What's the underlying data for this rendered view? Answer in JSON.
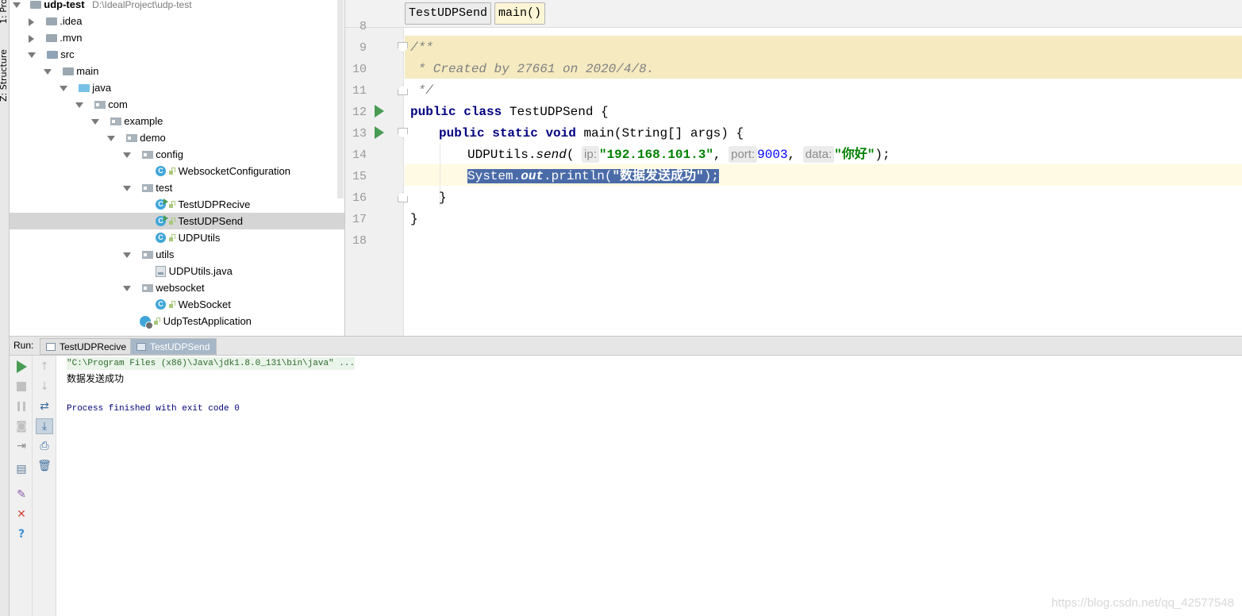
{
  "side_tabs": [
    "1: Pro",
    "Z: Structure"
  ],
  "project": {
    "root_name": "udp-test",
    "root_path": "D:\\IdealProject\\udp-test",
    "nodes": [
      ".idea",
      ".mvn",
      "src",
      "main",
      "java",
      "com",
      "example",
      "demo",
      "config",
      "WebsocketConfiguration",
      "test",
      "TestUDPRecive",
      "TestUDPSend",
      "UDPUtils",
      "utils",
      "UDPUtils.java",
      "websocket",
      "WebSocket",
      "UdpTestApplication"
    ],
    "selected": "TestUDPSend"
  },
  "editor": {
    "breadcrumbs": [
      "TestUDPSend",
      "main()"
    ],
    "line_numbers": [
      "8",
      "9",
      "10",
      "11",
      "12",
      "13",
      "14",
      "15",
      "16",
      "17",
      "18"
    ],
    "lines": {
      "l9": "/**",
      "l10": " * Created by 27661 on 2020/4/8.",
      "l11": " */",
      "l12_kw1": "public",
      "l12_kw2": "class",
      "l12_rest": " TestUDPSend {",
      "l13_kw1": "public",
      "l13_kw2": "static",
      "l13_kw3": "void",
      "l13_rest": " main(String[] args) {",
      "l14_pre": "UDPUtils.",
      "l14_method": "send",
      "l14_paren": "(",
      "l14_hint1": "ip:",
      "l14_str1": "\"192.168.101.3\"",
      "l14_comma1": ", ",
      "l14_hint2": "port:",
      "l14_num": "9003",
      "l14_comma2": ", ",
      "l14_hint3": "data:",
      "l14_str2": "\"你好\"",
      "l14_end": ");",
      "l15_pre": "System.",
      "l15_field": "out",
      "l15_mid": ".println(",
      "l15_str": "\"数据发送成功\"",
      "l15_end": ");",
      "l16": "}",
      "l17": "}"
    }
  },
  "run": {
    "label": "Run:",
    "tabs": [
      "TestUDPRecive",
      "TestUDPSend"
    ],
    "active_tab": "TestUDPSend",
    "console": {
      "command": "\"C:\\Program Files (x86)\\Java\\jdk1.8.0_131\\bin\\java\" ...",
      "output": "数据发送成功",
      "finished": "Process finished with exit code 0"
    }
  },
  "watermark": "https://blog.csdn.net/qq_42577548",
  "colors": {
    "keyword": "#000080",
    "string": "#008000",
    "number": "#0000ff",
    "selection": "#4a6ba8",
    "doc_highlight": "#f5eac0",
    "run_green": "#499c54"
  }
}
